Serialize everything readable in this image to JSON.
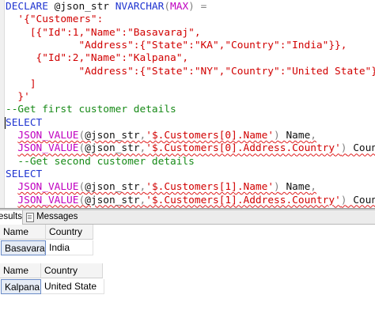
{
  "editor": {
    "lines": [
      {
        "tokens": [
          [
            "kw",
            "DECLARE "
          ],
          [
            "var",
            "@json_str "
          ],
          [
            "kw",
            "NVARCHAR"
          ],
          [
            "op",
            "("
          ],
          [
            "fn",
            "MAX"
          ],
          [
            "op",
            ") "
          ],
          [
            "op",
            "="
          ]
        ]
      },
      {
        "tokens": [
          [
            "str",
            "  '{\"Customers\":"
          ]
        ]
      },
      {
        "tokens": [
          [
            "str",
            "    [{\"Id\":1,\"Name\":\"Basavaraj\","
          ]
        ]
      },
      {
        "tokens": [
          [
            "str",
            "            \"Address\":{\"State\":\"KA\",\"Country\":\"India\"}},"
          ]
        ]
      },
      {
        "tokens": [
          [
            "str",
            "     {\"Id\":2,\"Name\":\"Kalpana\","
          ]
        ]
      },
      {
        "tokens": [
          [
            "str",
            "            \"Address\":{\"State\":\"NY\",\"Country\":\"United State\"}}"
          ]
        ]
      },
      {
        "tokens": [
          [
            "str",
            "    ]"
          ]
        ]
      },
      {
        "tokens": [
          [
            "str",
            "  }'"
          ]
        ]
      },
      {
        "tokens": [
          [
            "cmt",
            "--Get first customer details"
          ]
        ]
      },
      {
        "tokens": [
          [
            "kw",
            "SELECT"
          ]
        ],
        "caret": true
      },
      {
        "tokens": [
          [
            "plain",
            "  "
          ],
          [
            "fn",
            "JSON_VALUE"
          ],
          [
            "op",
            "("
          ],
          [
            "var",
            "@json_str"
          ],
          [
            "op",
            ","
          ],
          [
            "str",
            "'$.Customers[0].Name'"
          ],
          [
            "op",
            ")"
          ],
          [
            "plain",
            " Name"
          ],
          [
            "op",
            ","
          ]
        ],
        "squiggle": true
      },
      {
        "tokens": [
          [
            "plain",
            "  "
          ],
          [
            "fn",
            "JSON_VALUE"
          ],
          [
            "op",
            "("
          ],
          [
            "var",
            "@json_str"
          ],
          [
            "op",
            ","
          ],
          [
            "str",
            "'$.Customers[0].Address.Country'"
          ],
          [
            "op",
            ")"
          ],
          [
            "plain",
            " Country"
          ]
        ],
        "squiggle": true
      },
      {
        "tokens": [
          [
            "cmt",
            "  --Get second customer details"
          ]
        ]
      },
      {
        "tokens": [
          [
            "kw",
            "SELECT"
          ]
        ]
      },
      {
        "tokens": [
          [
            "plain",
            "  "
          ],
          [
            "fn",
            "JSON_VALUE"
          ],
          [
            "op",
            "("
          ],
          [
            "var",
            "@json_str"
          ],
          [
            "op",
            ","
          ],
          [
            "str",
            "'$.Customers[1].Name'"
          ],
          [
            "op",
            ")"
          ],
          [
            "plain",
            " Name"
          ],
          [
            "op",
            ","
          ]
        ],
        "squiggle": true
      },
      {
        "tokens": [
          [
            "plain",
            "  "
          ],
          [
            "fn",
            "JSON_VALUE"
          ],
          [
            "op",
            "("
          ],
          [
            "var",
            "@json_str"
          ],
          [
            "op",
            ","
          ],
          [
            "str",
            "'$.Customers[1].Address.Country'"
          ],
          [
            "op",
            ")"
          ],
          [
            "plain",
            " Country"
          ]
        ],
        "squiggle": true
      }
    ]
  },
  "status": {
    "zoom": "%"
  },
  "tabs": {
    "results": "esults",
    "messages": "Messages"
  },
  "grids": [
    {
      "headers": [
        "Name",
        "Country"
      ],
      "rows": [
        [
          "Basavaraj",
          "India"
        ]
      ]
    },
    {
      "headers": [
        "Name",
        "Country"
      ],
      "rows": [
        [
          "Kalpana",
          "United State"
        ]
      ]
    }
  ],
  "colors": {
    "keyword": "#1f34d0",
    "string": "#d10000",
    "function": "#c000c0",
    "comment": "#178a17"
  }
}
